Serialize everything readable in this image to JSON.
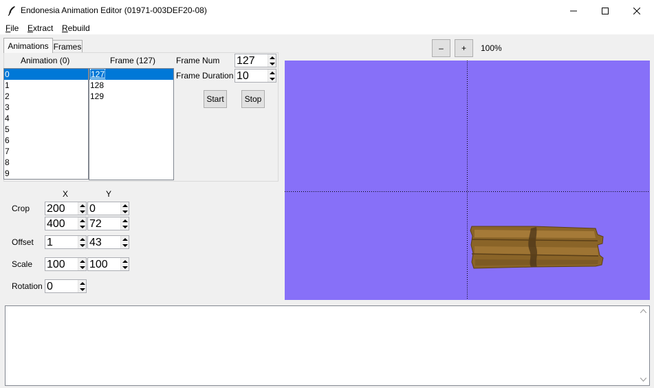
{
  "window": {
    "title": "Endonesia Animation Editor (01971-003DEF20-08)",
    "app_icon": "feather-icon",
    "controls": [
      "minimize-icon",
      "maximize-icon",
      "close-icon"
    ]
  },
  "menu": {
    "file": {
      "first": "F",
      "rest": "ile"
    },
    "extract": {
      "first": "E",
      "rest": "xtract"
    },
    "rebuild": {
      "first": "R",
      "rest": "ebuild"
    }
  },
  "tabs": {
    "animations": "Animations",
    "frames": "Frames"
  },
  "animation_list": {
    "header": "Animation (0)",
    "items": [
      "0",
      "1",
      "2",
      "3",
      "4",
      "5",
      "6",
      "7",
      "8",
      "9"
    ],
    "selected_index": 0
  },
  "frame_list": {
    "header": "Frame (127)",
    "items": [
      "127",
      "128",
      "129"
    ],
    "selected_index": 0
  },
  "frame_controls": {
    "frame_num_label": "Frame Num",
    "frame_num_value": "127",
    "frame_duration_label": "Frame Duration",
    "frame_duration_value": "10",
    "start_label": "Start",
    "stop_label": "Stop"
  },
  "transform": {
    "x_header": "X",
    "y_header": "Y",
    "crop_label": "Crop",
    "crop_x1": "200",
    "crop_y1": "0",
    "crop_x2": "400",
    "crop_y2": "72",
    "offset_label": "Offset",
    "offset_x": "1",
    "offset_y": "43",
    "scale_label": "Scale",
    "scale_x": "100",
    "scale_y": "100",
    "rotation_label": "Rotation",
    "rotation_value": "0"
  },
  "zoom": {
    "minus_label": "–",
    "plus_label": "+",
    "level": "100%"
  },
  "canvas": {
    "background_color": "#8770f8",
    "sprite": "wooden-plank-sign"
  },
  "console": {
    "text": ""
  }
}
